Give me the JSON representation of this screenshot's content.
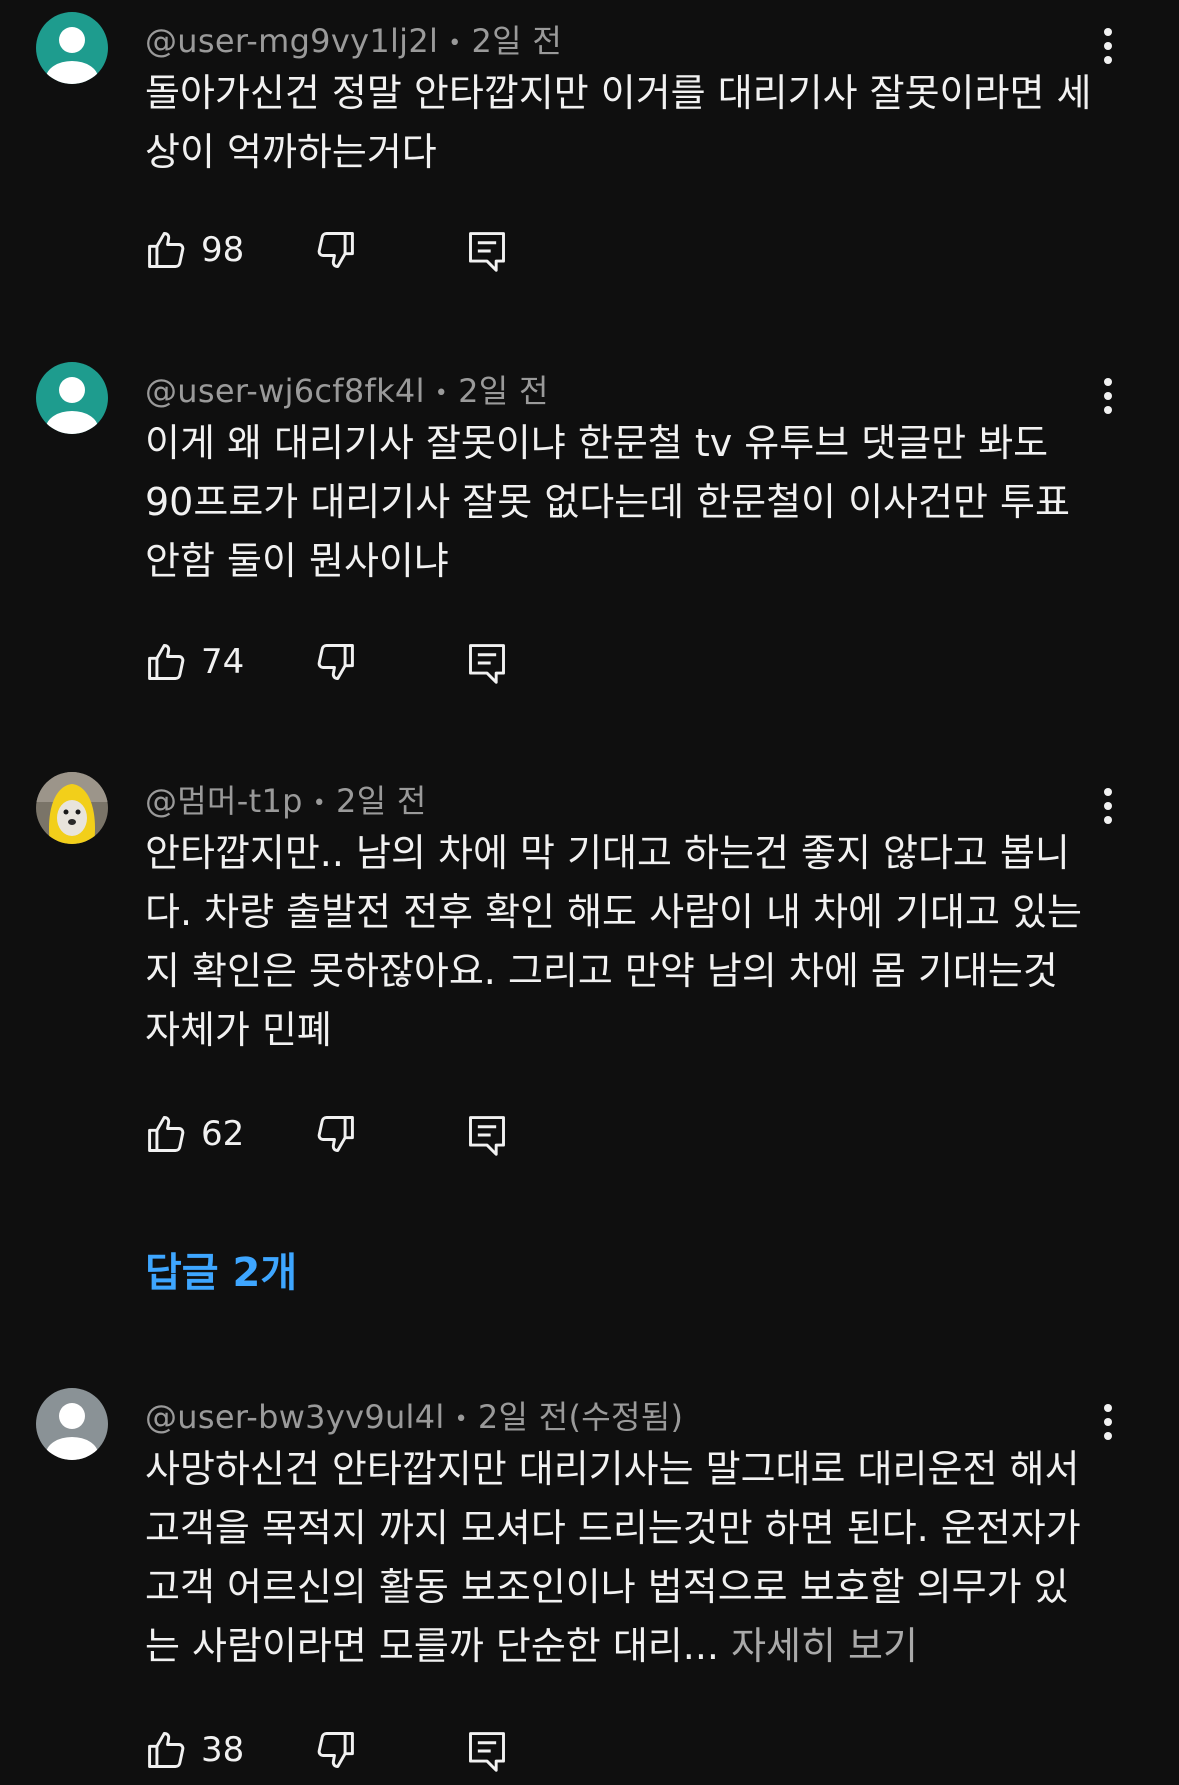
{
  "comments": [
    {
      "handle": "@user-mg9vy1lj2l",
      "time": "2일 전",
      "text": "돌아가신건 정말 안타깝지만 이거를 대리기사 잘못이라면 세상이 억까하는거다",
      "more": "",
      "likes": "98",
      "avatar": "default-teal"
    },
    {
      "handle": "@user-wj6cf8fk4l",
      "time": "2일 전",
      "text": "이게 왜 대리기사 잘못이냐 한문철 tv 유투브 댓글만 봐도 90프로가 대리기사 잘못 없다는데 한문철이 이사건만 투표안함 둘이 뭔사이냐",
      "more": "",
      "likes": "74",
      "avatar": "default-teal"
    },
    {
      "handle": "@멈머-t1p",
      "time": "2일 전",
      "text": "안타깝지만.. 남의 차에 막 기대고 하는건 좋지 않다고 봅니다. 차량 출발전 전후 확인 해도 사람이 내 차에 기대고 있는지 확인은 못하잖아요. 그리고 만약 남의 차에 몸 기대는것 자체가 민폐",
      "more": "",
      "likes": "62",
      "avatar": "dog-photo"
    },
    {
      "handle": "@user-bw3yv9ul4l",
      "time": "2일 전(수정됨)",
      "text": "사망하신건 안타깝지만 대리기사는 말그대로 대리운전 해서 고객을 목적지 까지 모셔다 드리는것만 하면 된다. 운전자가 고객 어르신의 활동 보조인이나 법적으로 보호할 의무가 있는 사람이라면 모를까 단순한 대리...",
      "more": " 자세히 보기",
      "likes": "38",
      "avatar": "default-gray"
    }
  ],
  "replies_link": "답글 2개",
  "icons": {
    "like": "thumbs-up-icon",
    "dislike": "thumbs-down-icon",
    "reply": "reply-icon",
    "menu": "more-vert-icon"
  },
  "colors": {
    "background": "#0f0f0f",
    "text": "#f1f1f1",
    "meta": "#9a9a9a",
    "link": "#3ea6ff",
    "avatar_teal": "#1e9c8e",
    "avatar_gray": "#8a9296"
  }
}
